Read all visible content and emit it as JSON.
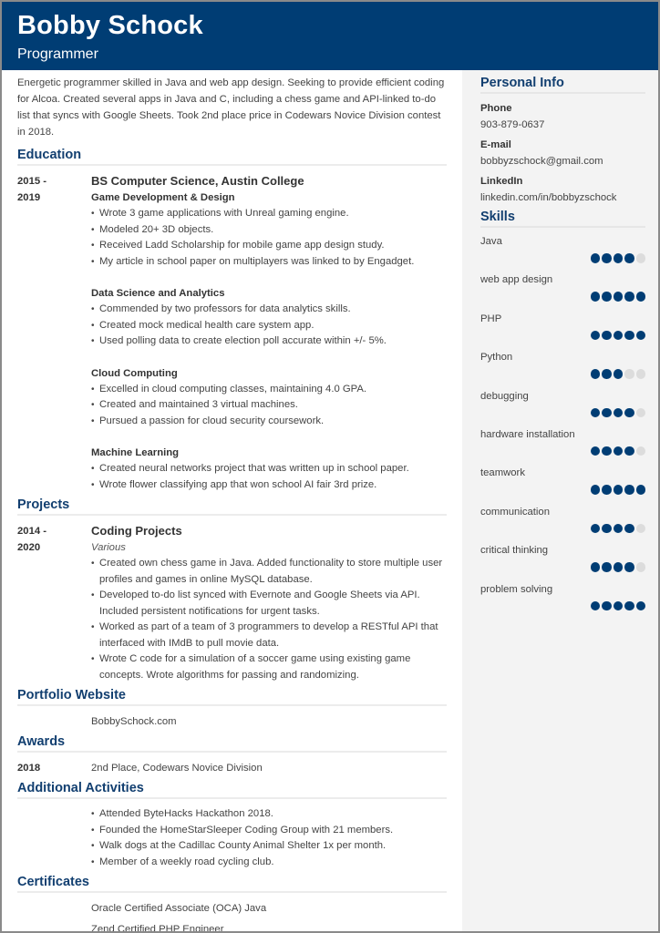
{
  "header": {
    "name": "Bobby Schock",
    "title": "Programmer"
  },
  "summary": "Energetic programmer skilled in Java and web app design. Seeking to provide efficient coding for Alcoa. Created several apps in Java and C, including a chess game and API-linked to-do list that syncs with Google Sheets. Took 2nd place price in Codewars Novice Division contest in 2018.",
  "education": {
    "heading": "Education",
    "date_start": "2015 -",
    "date_end": "2019",
    "degree": "BS Computer Science, Austin College",
    "groups": [
      {
        "title": "Game Development & Design",
        "items": [
          "Wrote 3 game applications with Unreal gaming engine.",
          "Modeled 20+ 3D objects.",
          "Received Ladd Scholarship for mobile game app design study.",
          "My article in school paper on multiplayers was linked to by Engadget."
        ]
      },
      {
        "title": "Data Science and Analytics",
        "items": [
          "Commended by two professors for data analytics skills.",
          "Created mock medical health care system app.",
          "Used polling data to create election poll accurate within +/- 5%."
        ]
      },
      {
        "title": "Cloud Computing",
        "items": [
          "Excelled in cloud computing classes, maintaining 4.0 GPA.",
          "Created and maintained 3 virtual machines.",
          "Pursued a passion for cloud security coursework."
        ]
      },
      {
        "title": "Machine Learning",
        "items": [
          "Created neural networks project that was written up in school paper.",
          "Wrote flower classifying app that won school AI fair 3rd prize."
        ]
      }
    ]
  },
  "projects": {
    "heading": "Projects",
    "date_start": "2014 -",
    "date_end": "2020",
    "title": "Coding Projects",
    "subtitle": "Various",
    "items": [
      "Created own chess game in Java. Added functionality to store multiple user profiles and games in online MySQL database.",
      "Developed to-do list synced with Evernote and Google Sheets via API. Included persistent notifications for urgent tasks.",
      "Worked as part of a team of 3 programmers to develop a RESTful API that interfaced with IMdB to pull movie data.",
      "Wrote C code for a simulation of a soccer game using existing game concepts. Wrote algorithms for passing and randomizing."
    ]
  },
  "portfolio": {
    "heading": "Portfolio Website",
    "url": "BobbySchock.com"
  },
  "awards": {
    "heading": "Awards",
    "year": "2018",
    "text": "2nd Place, Codewars Novice Division"
  },
  "activities": {
    "heading": "Additional Activities",
    "items": [
      "Attended ByteHacks Hackathon 2018.",
      "Founded the HomeStarSleeper Coding Group with 21 members.",
      "Walk dogs at the Cadillac County Animal Shelter 1x per month.",
      "Member of a weekly road cycling club."
    ]
  },
  "certificates": {
    "heading": "Certificates",
    "items": [
      "Oracle Certified Associate (OCA) Java",
      "Zend Certified PHP Engineer"
    ]
  },
  "personal_info": {
    "heading": "Personal Info",
    "fields": [
      {
        "label": "Phone",
        "value": "903-879-0637"
      },
      {
        "label": "E-mail",
        "value": "bobbyzschock@gmail.com"
      },
      {
        "label": "LinkedIn",
        "value": "linkedin.com/in/bobbyzschock"
      }
    ]
  },
  "skills": {
    "heading": "Skills",
    "max_level": 5,
    "items": [
      {
        "name": "Java",
        "level": 4
      },
      {
        "name": "web app design",
        "level": 5
      },
      {
        "name": "PHP",
        "level": 5
      },
      {
        "name": "Python",
        "level": 3
      },
      {
        "name": "debugging",
        "level": 4
      },
      {
        "name": "hardware installation",
        "level": 4
      },
      {
        "name": "teamwork",
        "level": 5
      },
      {
        "name": "communication",
        "level": 4
      },
      {
        "name": "critical thinking",
        "level": 4
      },
      {
        "name": "problem solving",
        "level": 5
      }
    ]
  },
  "colors": {
    "accent": "#003d74",
    "heading": "#123f70",
    "sidebar_bg": "#f3f3f3",
    "dot_off": "#dcdcdc"
  }
}
